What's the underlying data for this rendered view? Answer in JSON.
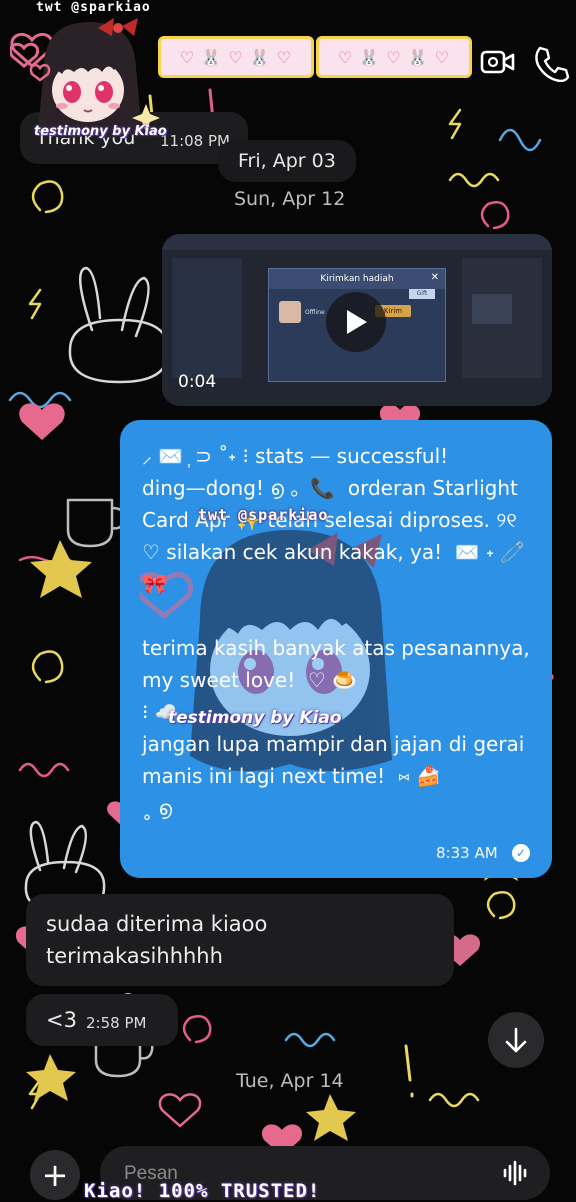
{
  "header": {
    "watermark_handle": "twt @sparkiao",
    "heart_strip_1": "♡ 🐰 ♡ 🐰 ♡",
    "heart_strip_2": "♡ 🐰 ♡ 🐰 ♡",
    "video_call_icon": "video-camera-icon",
    "phone_call_icon": "phone-icon"
  },
  "watermark": {
    "handle": "twt @sparkiao",
    "testimony": "testimony by Kiao",
    "trusted_banner": "Kiao! 100% TRUSTED!"
  },
  "messages": {
    "first_partial": {
      "text": "Thank you ",
      "time": "11:08 PM"
    },
    "date_1": "Fri, Apr 03",
    "date_2": "Sun, Apr 12",
    "video": {
      "duration": "0:04",
      "dialog_title": "Kirimkan hadiah",
      "dialog_status": "Offline",
      "dialog_action": "Kirim",
      "dialog_tab": "Gift"
    },
    "outgoing": {
      "text": "⸝ ✉️ ᷂ ⊃ ˚˖ ⁝ stats — successful!\nding—dong! ൭ 。📞  orderan Starlight Card Apr ✨ telah selesai diproses. ୨୧ ♡ silakan cek akun kakak, ya!  ✉️ ˖ 🧷 🎀\n\nterima kasih banyak atas pesanannya, my sweet love!  ♡ 🍮\n⁝ ☁️\njangan lupa mampir dan jajan di gerai manis ini lagi next time!  ⑅ 🍰\n˳ ൭",
      "time": "8:33 AM"
    },
    "reply_1": {
      "text": "sudaa diterima kiaoo terimakasihhhhh"
    },
    "reply_2": {
      "text": "<3",
      "time": "2:58 PM"
    },
    "date_3": "Tue, Apr 14"
  },
  "composer": {
    "placeholder": "Pesan",
    "plus_icon": "plus-icon",
    "mic_icon": "waveform-mic-icon"
  },
  "colors": {
    "background": "#060607",
    "outgoing_bubble": "#2d92e6",
    "incoming_bubble": "#1d1d1f",
    "accent_pink": "#e85f8f",
    "accent_yellow": "#f7d44a"
  }
}
